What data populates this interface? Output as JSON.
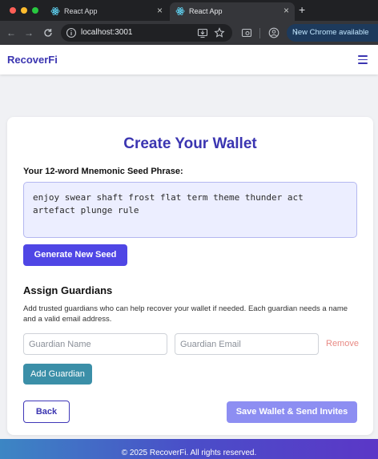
{
  "browser": {
    "tabs": [
      {
        "title": "React App",
        "active": false
      },
      {
        "title": "React App",
        "active": true
      }
    ],
    "url": "localhost:3001",
    "update_label": "New Chrome available"
  },
  "app": {
    "brand": "RecoverFi"
  },
  "wallet": {
    "title": "Create Your Wallet",
    "seed_label": "Your 12-word Mnemonic Seed Phrase:",
    "seed_phrase": "enjoy swear shaft frost flat term theme thunder act artefact plunge rule",
    "generate_button": "Generate New Seed"
  },
  "guardians": {
    "heading": "Assign Guardians",
    "description": "Add trusted guardians who can help recover your wallet if needed. Each guardian needs a name and a valid email address.",
    "name_placeholder": "Guardian Name",
    "email_placeholder": "Guardian Email",
    "remove_label": "Remove",
    "add_button": "Add Guardian"
  },
  "actions": {
    "back": "Back",
    "save": "Save Wallet & Send Invites"
  },
  "footer": {
    "text": "© 2025 RecoverFi. All rights reserved."
  },
  "colors": {
    "brand": "#3b35b1",
    "primary_button": "#4f46e5",
    "add_button": "#3b8fa8",
    "save_button": "#8d8ef2",
    "remove_link": "#e88a84"
  }
}
